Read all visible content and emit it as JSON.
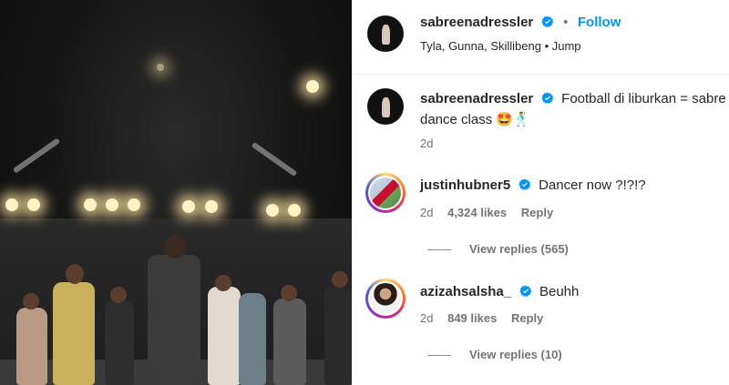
{
  "post": {
    "author": "sabreenadressler",
    "follow_label": "Follow",
    "separator": "•",
    "audio": "Tyla, Gunna, Skillibeng • Jump"
  },
  "caption": {
    "author": "sabreenadressler",
    "text_line1": "Football di liburkan = sabre",
    "text_line2": "dance class 🤩🕺",
    "time": "2d"
  },
  "comments": [
    {
      "author": "justinhubner5",
      "text": "Dancer now ?!?!?",
      "time": "2d",
      "likes": "4,324 likes",
      "reply_label": "Reply",
      "view_replies": "View replies (565)"
    },
    {
      "author": "azizahsalsha_",
      "text": "Beuhh",
      "time": "2d",
      "likes": "849 likes",
      "reply_label": "Reply",
      "view_replies": "View replies (10)"
    }
  ],
  "colors": {
    "accent": "#0095f6",
    "verified": "#0095f6",
    "muted": "#737373"
  },
  "icons": [
    "verified-badge-icon"
  ]
}
